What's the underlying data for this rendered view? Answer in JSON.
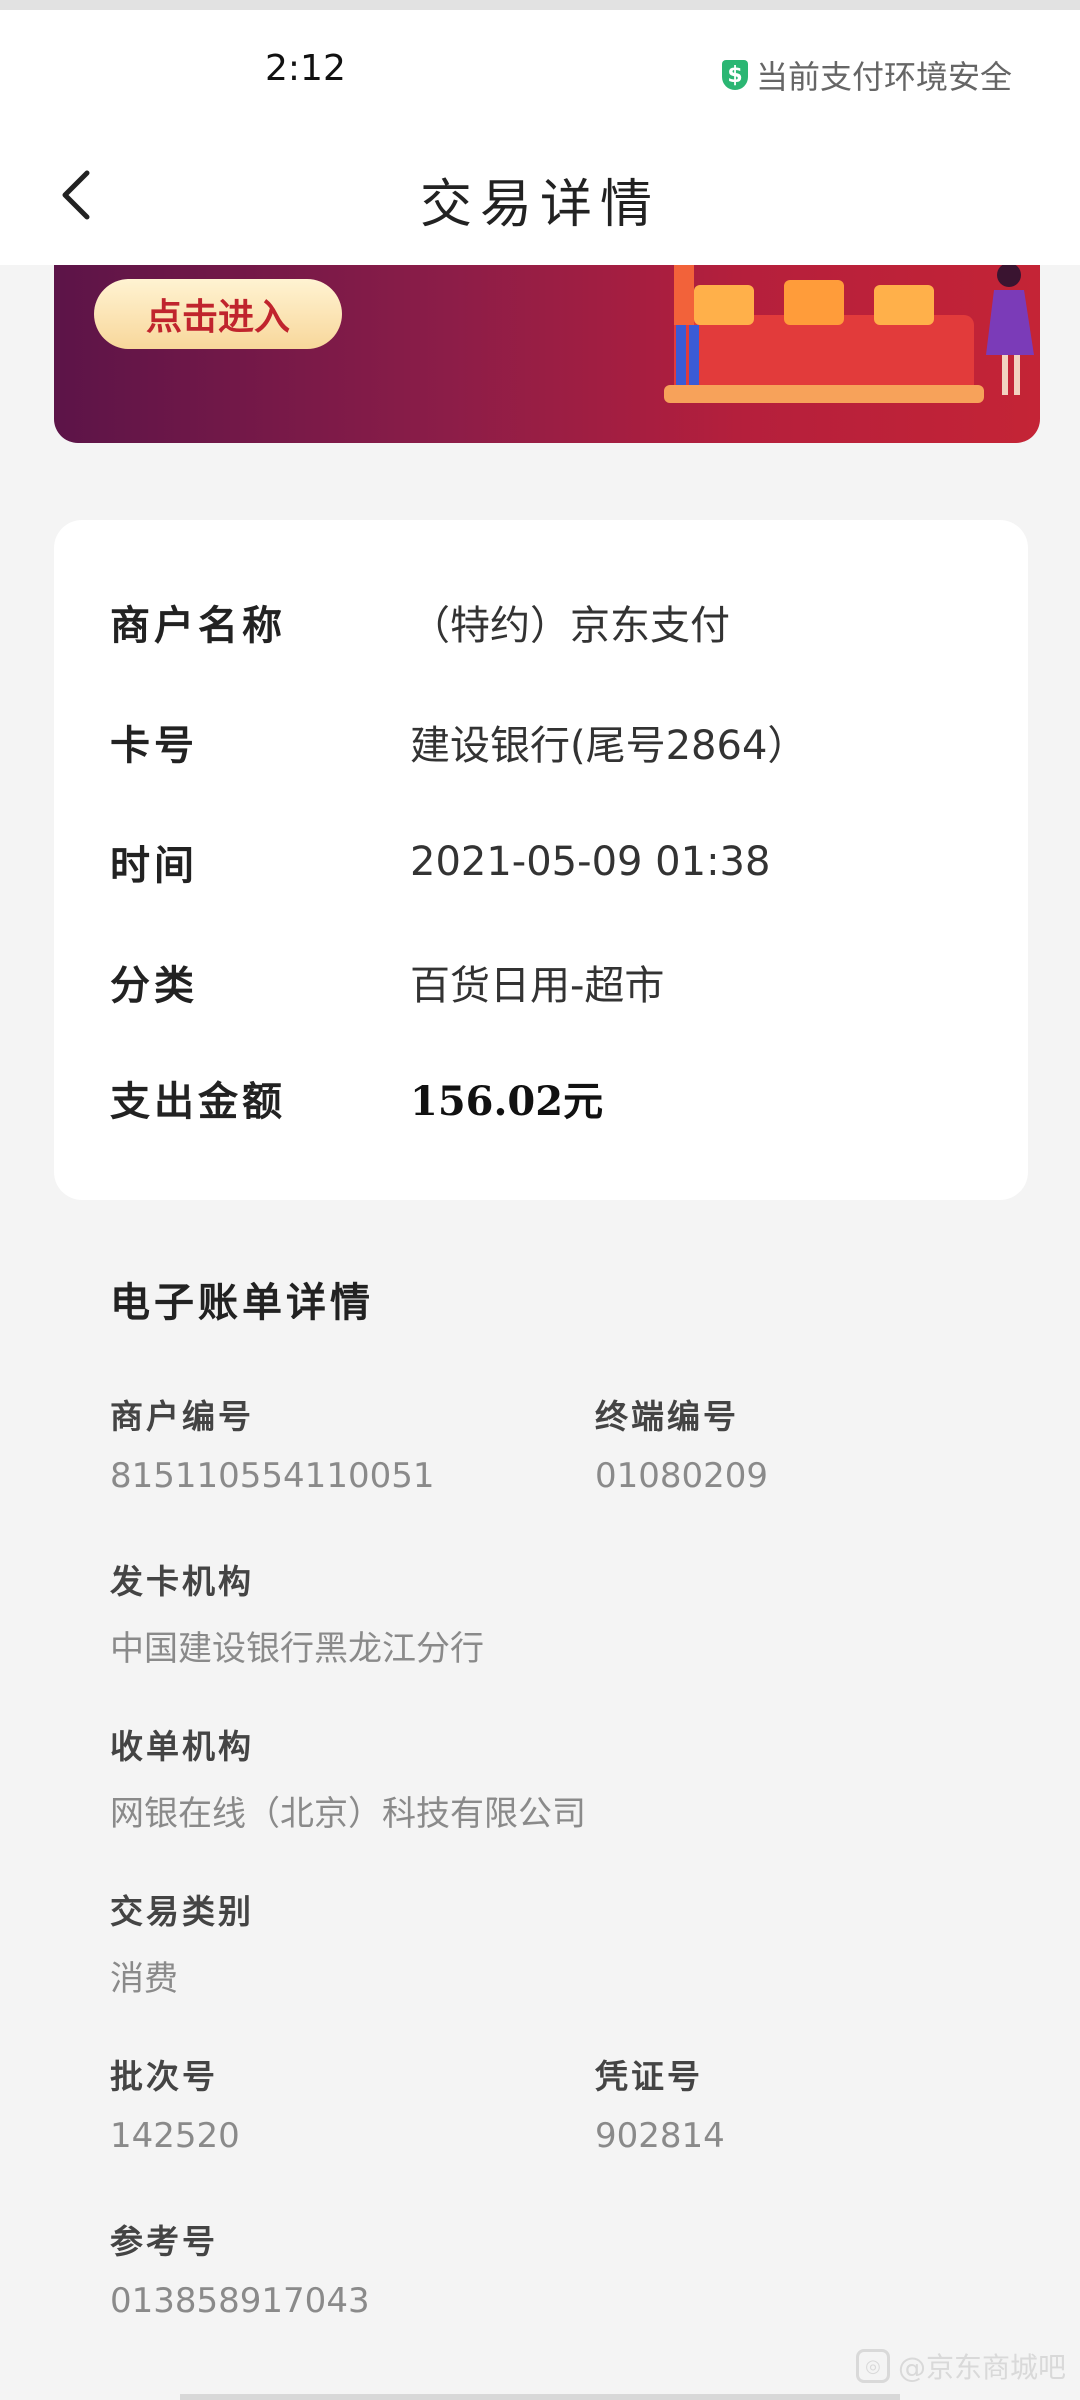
{
  "status_bar": {
    "time": "2:12",
    "secure_text": "当前支付环境安全"
  },
  "nav": {
    "title": "交易详情"
  },
  "banner": {
    "button_label": "点击进入"
  },
  "info": {
    "merchant_label": "商户名称",
    "merchant_value": "（特约）京东支付",
    "card_label": "卡号",
    "card_value": "建设银行(尾号2864）",
    "time_label": "时间",
    "time_value": "2021-05-09  01:38",
    "category_label": "分类",
    "category_value": "百货日用-超市",
    "amount_label": "支出金额",
    "amount_value": "156.02元"
  },
  "bill": {
    "title": "电子账单详情",
    "merchant_no_label": "商户编号",
    "merchant_no_value": "815110554110051",
    "terminal_no_label": "终端编号",
    "terminal_no_value": "01080209",
    "issuer_label": "发卡机构",
    "issuer_value": "中国建设银行黑龙江分行",
    "acquirer_label": "收单机构",
    "acquirer_value": "网银在线（北京）科技有限公司",
    "type_label": "交易类别",
    "type_value": "消费",
    "batch_label": "批次号",
    "batch_value": "142520",
    "voucher_label": "凭证号",
    "voucher_value": "902814",
    "ref_label": "参考号",
    "ref_value": "013858917043"
  },
  "watermark": {
    "text": "@京东商城吧"
  },
  "colors": {
    "secure_green": "#2bb673",
    "banner_red": "#c42436",
    "button_text": "#c0242d"
  }
}
